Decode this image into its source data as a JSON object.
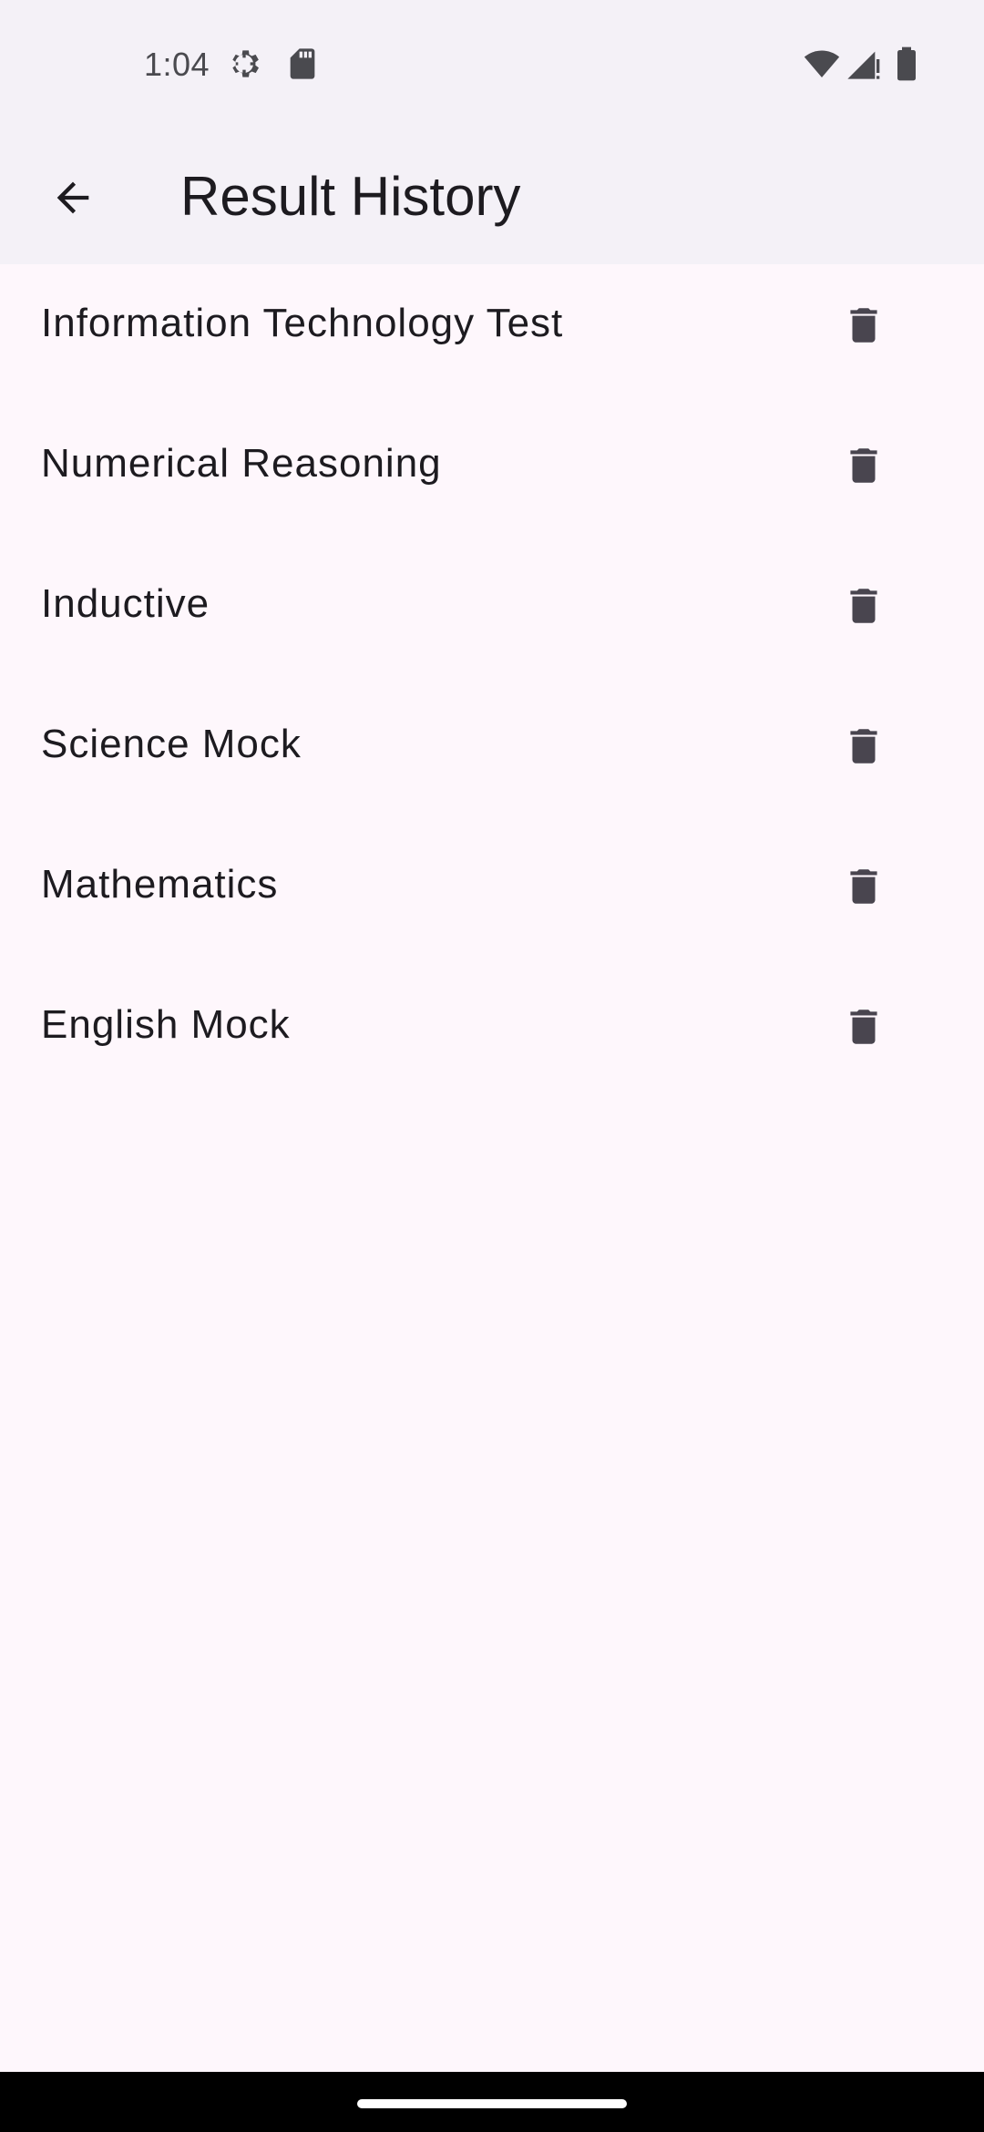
{
  "status_bar": {
    "time": "1:04",
    "icons": [
      "settings-gear-icon",
      "sd-card-icon",
      "wifi-icon",
      "cell-signal-icon",
      "battery-icon"
    ]
  },
  "app_bar": {
    "back_icon": "arrow-back-icon",
    "title": "Result History"
  },
  "results": [
    {
      "label": "Information Technology Test",
      "action_icon": "delete-icon"
    },
    {
      "label": "Numerical Reasoning",
      "action_icon": "delete-icon"
    },
    {
      "label": "Inductive",
      "action_icon": "delete-icon"
    },
    {
      "label": "Science Mock",
      "action_icon": "delete-icon"
    },
    {
      "label": "Mathematics",
      "action_icon": "delete-icon"
    },
    {
      "label": "English Mock",
      "action_icon": "delete-icon"
    }
  ],
  "colors": {
    "background": "#FEF7FC",
    "app_bar": "#F4F1F7",
    "text": "#1D1B20",
    "icon": "#49454F"
  }
}
